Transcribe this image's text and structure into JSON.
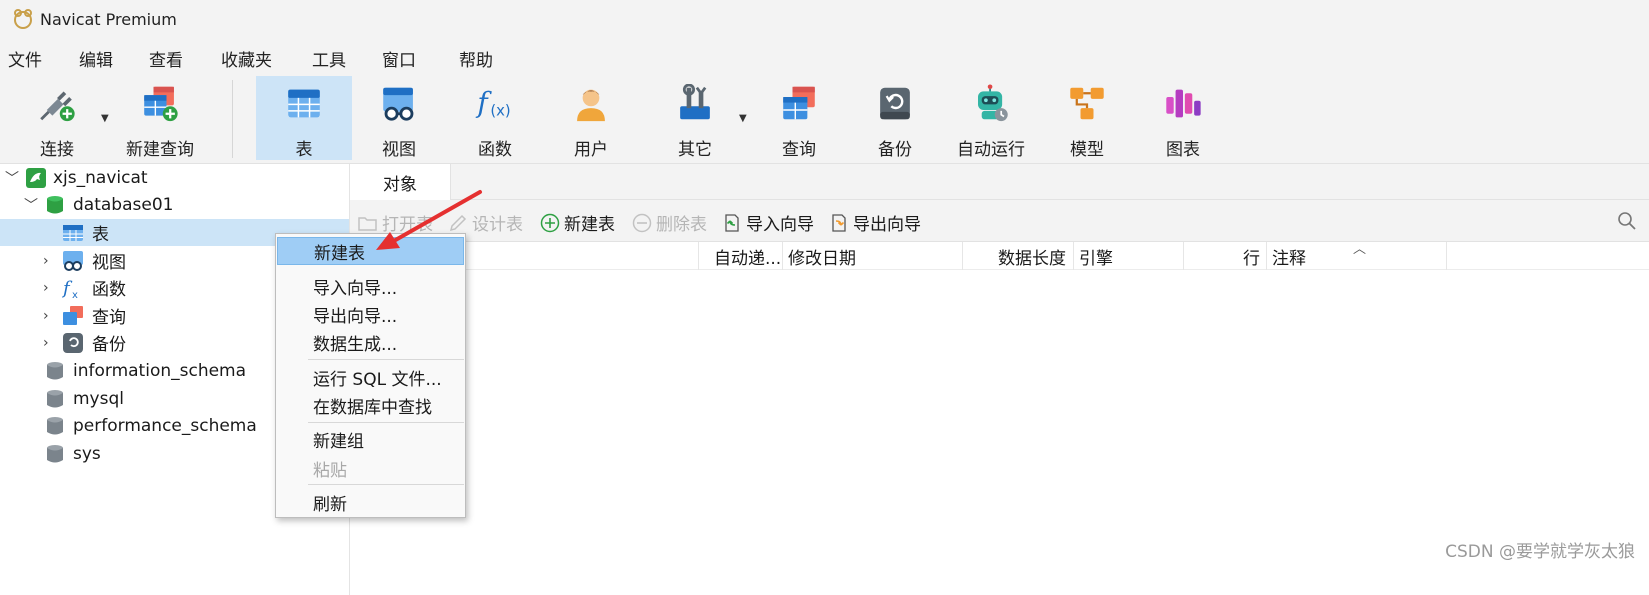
{
  "window": {
    "title": "Navicat Premium"
  },
  "menubar": [
    "文件",
    "编辑",
    "查看",
    "收藏夹",
    "工具",
    "窗口",
    "帮助"
  ],
  "toolbar": {
    "connect": "连接",
    "new_query": "新建查询",
    "table": "表",
    "view": "视图",
    "function": "函数",
    "user": "用户",
    "other": "其它",
    "query": "查询",
    "backup": "备份",
    "automation": "自动运行",
    "model": "模型",
    "chart": "图表"
  },
  "tree": {
    "connection": "xjs_navicat",
    "database": "database01",
    "children": [
      "表",
      "视图",
      "函数",
      "查询",
      "备份"
    ],
    "other_dbs": [
      "information_schema",
      "mysql",
      "performance_schema",
      "sys"
    ]
  },
  "tabs": {
    "object": "对象"
  },
  "object_toolbar": {
    "open_table": "打开表",
    "design_table": "设计表",
    "new_table": "新建表",
    "delete_table": "删除表",
    "import_wizard": "导入向导",
    "export_wizard": "导出向导"
  },
  "columns": [
    "自动递...",
    "修改日期",
    "数据长度",
    "引擎",
    "行",
    "注释"
  ],
  "context_menu": {
    "new_table": "新建表",
    "import_wizard": "导入向导...",
    "export_wizard": "导出向导...",
    "data_generation": "数据生成...",
    "run_sql": "运行 SQL 文件...",
    "find_in_db": "在数据库中查找",
    "new_group": "新建组",
    "paste": "粘贴",
    "refresh": "刷新"
  },
  "watermark": "CSDN @要学就学灰太狼",
  "colors": {
    "selection": "#cce4f7",
    "menu_highlight": "#9fcdf5",
    "arrow": "#e53030"
  }
}
